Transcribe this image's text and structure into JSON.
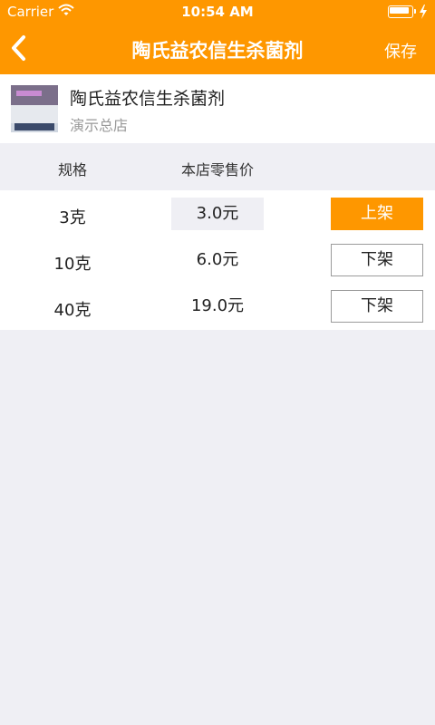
{
  "status_bar": {
    "carrier": "Carrier",
    "time": "10:54 AM"
  },
  "nav": {
    "title": "陶氏益农信生杀菌剂",
    "save_label": "保存"
  },
  "product": {
    "name": "陶氏益农信生杀菌剂",
    "store": "演示总店"
  },
  "table": {
    "headers": {
      "spec": "规格",
      "price": "本店零售价"
    },
    "rows": [
      {
        "spec": "3克",
        "price": "3.0元",
        "action": "上架"
      },
      {
        "spec": "10克",
        "price": "6.0元",
        "action": "下架"
      },
      {
        "spec": "40克",
        "price": "19.0元",
        "action": "下架"
      }
    ]
  },
  "colors": {
    "accent": "#fe9700",
    "background": "#efeff4"
  }
}
